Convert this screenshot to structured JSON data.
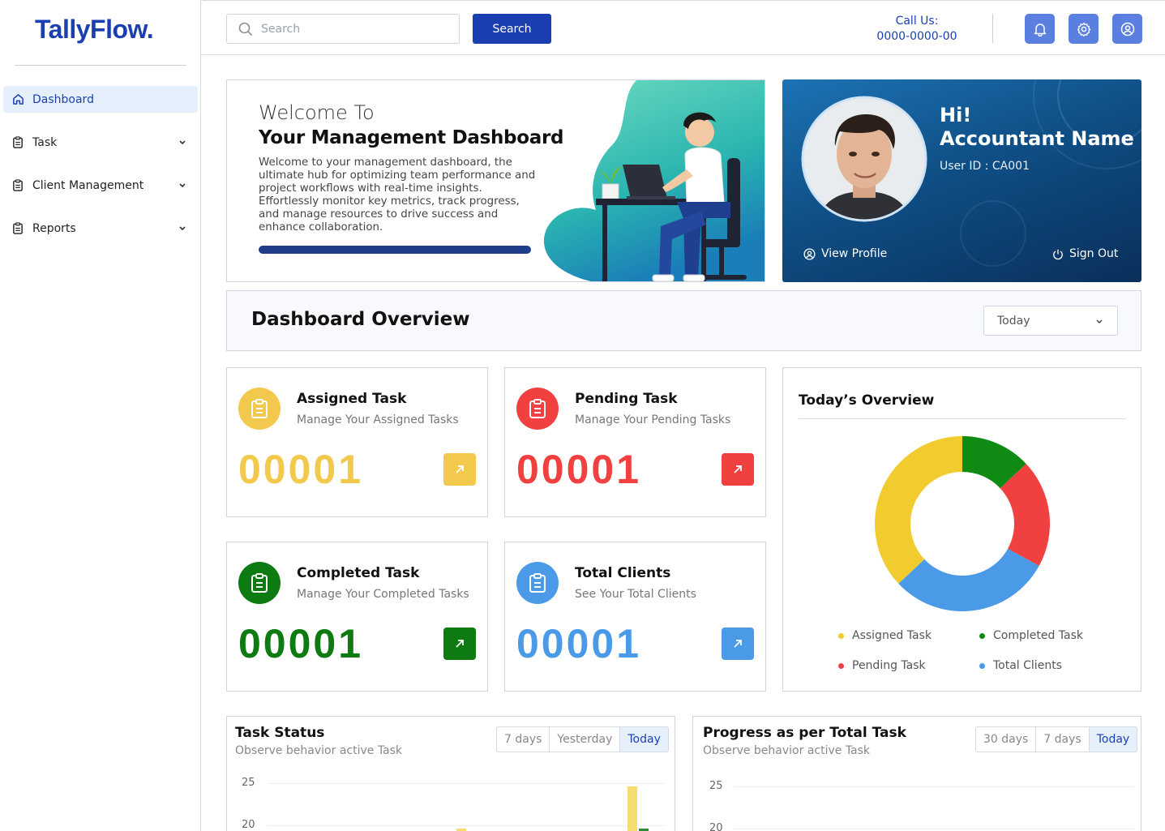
{
  "brand": {
    "logo": "TallyFlow."
  },
  "sidebar": {
    "items": [
      {
        "label": "Dashboard",
        "icon": "home-icon",
        "active": true
      },
      {
        "label": "Task",
        "icon": "clipboard-icon"
      },
      {
        "label": "Client Management",
        "icon": "clipboard-icon"
      },
      {
        "label": "Reports",
        "icon": "clipboard-icon"
      }
    ]
  },
  "header": {
    "search": {
      "placeholder": "Search",
      "button": "Search"
    },
    "call_label": "Call Us:",
    "call_number": "0000-0000-00",
    "icons": [
      "bell-icon",
      "settings-icon",
      "user-circle-icon"
    ]
  },
  "welcome": {
    "line1": "Welcome To",
    "line2": "Your Management Dashboard",
    "body": "Welcome to your management dashboard, the ultimate hub for optimizing team performance and project workflows with real-time insights. Effortlessly monitor key metrics, track progress, and manage resources to drive success and enhance collaboration."
  },
  "profile": {
    "greeting": "Hi!",
    "name": "Accountant Name",
    "user_id": "User ID : CA001",
    "view_profile": "View Profile",
    "sign_out": "Sign Out"
  },
  "overview": {
    "title": "Dashboard Overview",
    "period": "Today"
  },
  "stats": [
    {
      "title": "Assigned Task",
      "subtitle": "Manage Your Assigned Tasks",
      "value": "00001",
      "color": "#f2c94c"
    },
    {
      "title": "Pending Task",
      "subtitle": "Manage Your Pending Tasks",
      "value": "00001",
      "color": "#f04040"
    },
    {
      "title": "Completed Task",
      "subtitle": "Manage Your Completed Tasks",
      "value": "00001",
      "color": "#0d7a12"
    },
    {
      "title": "Total Clients",
      "subtitle": "See Your Total Clients",
      "value": "00001",
      "color": "#4a9ae8"
    }
  ],
  "today_overview": {
    "title": "Today’s Overview",
    "legend": [
      "Assigned Task",
      "Completed Task",
      "Pending Task",
      "Total Clients"
    ]
  },
  "chart_data": [
    {
      "type": "pie",
      "title": "Today’s Overview",
      "categories": [
        "Assigned Task",
        "Completed Task",
        "Pending Task",
        "Total Clients"
      ],
      "values": [
        37,
        13,
        20,
        30
      ],
      "colors": [
        "#f2cc2e",
        "#0f8a12",
        "#f04040",
        "#4a9ae8"
      ]
    },
    {
      "type": "bar",
      "title": "Task Status",
      "ylim": [
        0,
        25
      ],
      "yticks": [
        25,
        20
      ]
    },
    {
      "type": "bar",
      "title": "Progress as per Total Task",
      "ylim": [
        0,
        25
      ],
      "yticks": [
        25,
        20
      ]
    }
  ],
  "task_status": {
    "title": "Task Status",
    "subtitle": "Observe behavior active Task",
    "tabs": [
      "7 days",
      "Yesterday",
      "Today"
    ],
    "yticks": [
      "25",
      "20"
    ]
  },
  "progress": {
    "title": "Progress as per Total Task",
    "subtitle": "Observe behavior active Task",
    "tabs": [
      "30 days",
      "7 days",
      "Today"
    ],
    "yticks": [
      "25",
      "20"
    ]
  }
}
